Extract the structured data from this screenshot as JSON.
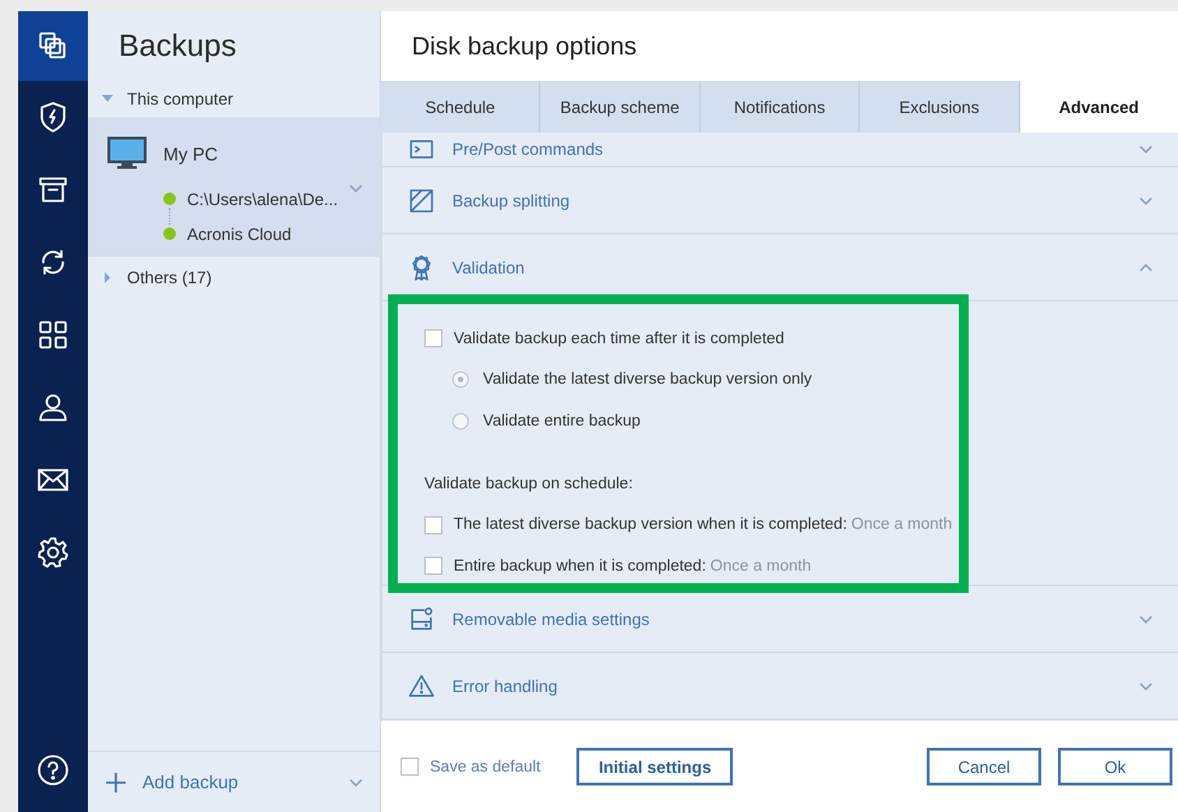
{
  "nav": {
    "items": [
      {
        "kind": "copies",
        "selected": true
      },
      {
        "kind": "shield",
        "selected": false
      },
      {
        "kind": "archive",
        "selected": false
      },
      {
        "kind": "sync",
        "selected": false
      },
      {
        "kind": "grid",
        "selected": false
      },
      {
        "kind": "person",
        "selected": false
      },
      {
        "kind": "mail",
        "selected": false
      },
      {
        "kind": "gear",
        "selected": false
      },
      {
        "kind": "help",
        "selected": false
      }
    ]
  },
  "sidebar": {
    "title": "Backups",
    "groups": [
      {
        "label": "This computer",
        "expanded": true,
        "children": [
          {
            "name": "My PC",
            "selected": true,
            "destinations": [
              {
                "label": "C:\\Users\\alena\\De...",
                "color": "#8cc414"
              },
              {
                "label": "Acronis Cloud",
                "color": "#8cc414"
              }
            ]
          }
        ]
      },
      {
        "label": "Others (17)",
        "expanded": false
      }
    ],
    "add_button": "Add backup"
  },
  "dialog": {
    "title": "Disk backup options",
    "tabs": [
      {
        "label": "Schedule",
        "selected": false
      },
      {
        "label": "Backup scheme",
        "selected": false
      },
      {
        "label": "Notifications",
        "selected": false
      },
      {
        "label": "Exclusions",
        "selected": false
      },
      {
        "label": "Advanced",
        "selected": true
      }
    ],
    "sections": [
      {
        "label": "Pre/Post commands",
        "kind": "terminal",
        "expanded": false
      },
      {
        "label": "Backup splitting",
        "kind": "split",
        "expanded": false
      },
      {
        "label": "Validation",
        "kind": "ribbon",
        "expanded": true,
        "options": [
          {
            "kind": "checkbox",
            "label": "Validate backup each time after it is completed",
            "checked": false
          },
          {
            "kind": "radio",
            "label": "Validate the latest diverse backup version only",
            "selected": true
          },
          {
            "kind": "radio",
            "label": "Validate entire backup",
            "selected": false
          },
          {
            "kind": "heading",
            "label": "Validate backup on schedule:"
          },
          {
            "kind": "checkbox",
            "label": "The latest diverse backup version when it is completed:",
            "value": "Once a month",
            "checked": false
          },
          {
            "kind": "checkbox",
            "label": "Entire backup when it is completed:",
            "value": "Once a month",
            "checked": false
          }
        ]
      },
      {
        "label": "Removable media settings",
        "kind": "drive",
        "expanded": false
      },
      {
        "label": "Error handling",
        "kind": "warning",
        "expanded": false
      }
    ],
    "save_default": {
      "label": "Save as default",
      "checked": false
    },
    "buttons": [
      "Initial settings",
      "Cancel",
      "Ok"
    ]
  }
}
